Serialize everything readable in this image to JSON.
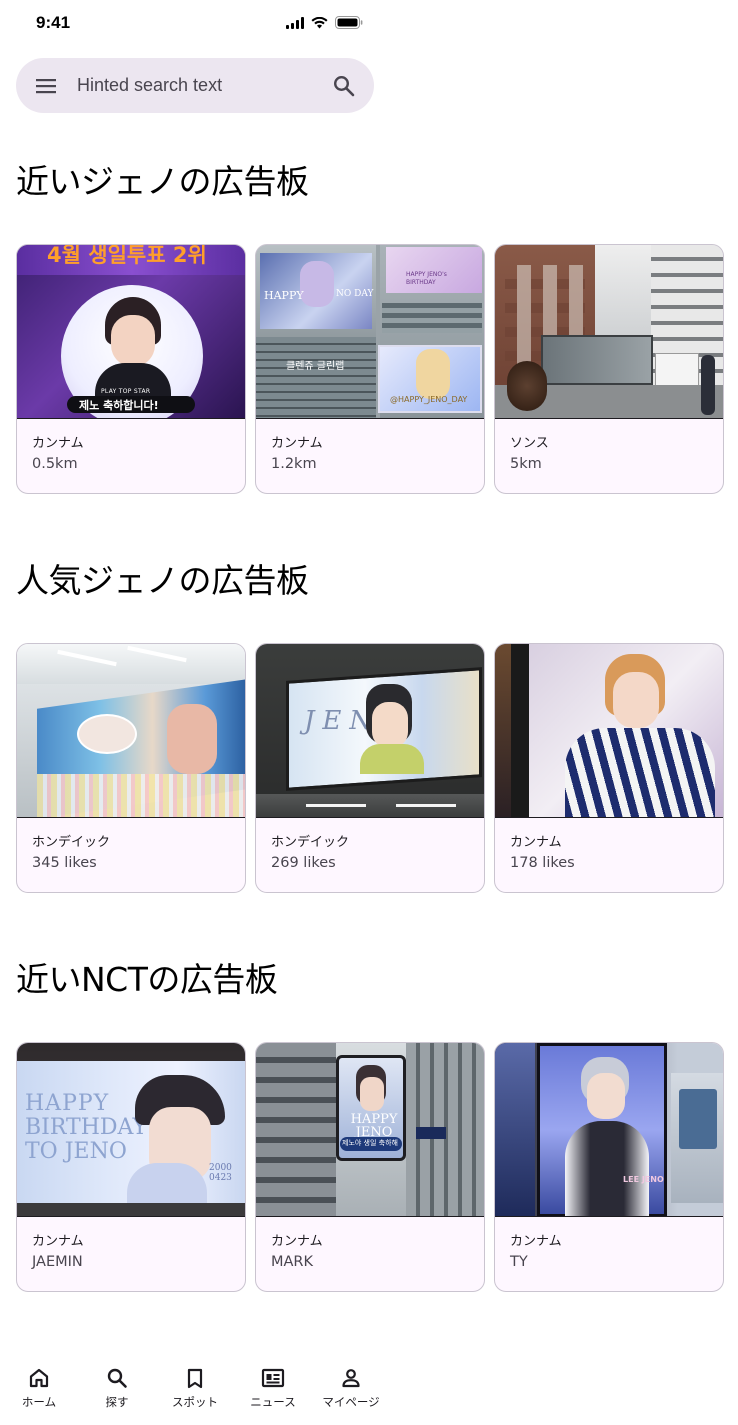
{
  "status": {
    "time": "9:41"
  },
  "search": {
    "placeholder": "Hinted search text"
  },
  "sections": [
    {
      "title": "近いジェノの広告板",
      "cards": [
        {
          "subhead": "カンナム",
          "value": "0.5km",
          "image": "jeno-birthday-vote-ad"
        },
        {
          "subhead": "カンナム",
          "value": "1.2km",
          "image": "jeno-building-billboards"
        },
        {
          "subhead": "ソンス",
          "value": "5km",
          "image": "street-truck-billboard"
        }
      ]
    },
    {
      "title": "人気ジェノの広告板",
      "cards": [
        {
          "subhead": "ホンデイック",
          "value": "345 likes",
          "image": "subway-wall-banner"
        },
        {
          "subhead": "ホンデイック",
          "value": "269 likes",
          "image": "subway-lightbox-jeno"
        },
        {
          "subhead": "カンナム",
          "value": "178 likes",
          "image": "station-pillar-ad"
        }
      ]
    },
    {
      "title": "近いNCTの広告板",
      "cards": [
        {
          "subhead": "カンナム",
          "value": "JAEMIN",
          "image": "happy-birthday-jeno-banner"
        },
        {
          "subhead": "カンナム",
          "value": "MARK",
          "image": "building-screen-ad"
        },
        {
          "subhead": "カンナム",
          "value": "TY",
          "image": "subway-pillar-lee-jeno"
        }
      ]
    }
  ],
  "image_text": {
    "card1_top": "4월 생일투표 2위",
    "card1_badge": "PLAY TOP STAR",
    "card1_caption": "제노 축하합니다!",
    "card2_happy": "HAPPY",
    "card2_noday": "NO DAY",
    "card2_jeno": "HAPPY JENO's BIRTHDAY",
    "card2_sign": "클렌쥬 글린랩",
    "card2_tag": "@HAPPY_JENO_DAY",
    "card7_line1": "HAPPY",
    "card7_line2": "BIRTHDAY",
    "card7_line3": "TO JENO",
    "card7_date": "2000 0423",
    "card8_screen": "HAPPY JENO",
    "card8_caption": "제노야 생일 축하해",
    "card9_name": "LEE JENO",
    "card5_sign": "JENO"
  },
  "nav": [
    {
      "label": "ホーム",
      "icon": "home-icon"
    },
    {
      "label": "探す",
      "icon": "search-icon"
    },
    {
      "label": "スポット",
      "icon": "bookmark-icon"
    },
    {
      "label": "ニュース",
      "icon": "news-icon"
    },
    {
      "label": "マイページ",
      "icon": "person-icon"
    }
  ],
  "colors": {
    "search_bg": "#ece6f0",
    "card_bg": "#fef7ff",
    "card_border": "#cac4d0"
  }
}
